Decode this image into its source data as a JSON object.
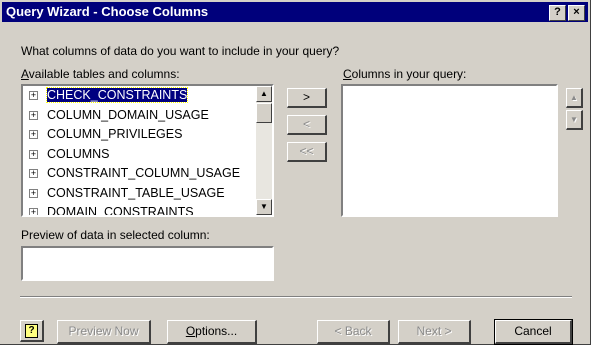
{
  "window": {
    "title": "Query Wizard - Choose Columns",
    "help_glyph": "?",
    "close_glyph": "×"
  },
  "prompt": "What columns of data do you want to include in your query?",
  "available": {
    "label_access": "A",
    "label_rest": "vailable tables and columns:",
    "items": [
      {
        "label": "CHECK_CONSTRAINTS",
        "selected": true
      },
      {
        "label": "COLUMN_DOMAIN_USAGE"
      },
      {
        "label": "COLUMN_PRIVILEGES"
      },
      {
        "label": "COLUMNS"
      },
      {
        "label": "CONSTRAINT_COLUMN_USAGE"
      },
      {
        "label": "CONSTRAINT_TABLE_USAGE"
      },
      {
        "label": "DOMAIN_CONSTRAINTS"
      }
    ],
    "expander_glyph": "+"
  },
  "move_buttons": {
    "add": ">",
    "remove": "<",
    "remove_all": "<<"
  },
  "query_columns": {
    "label_access": "C",
    "label_rest": "olumns in your query:"
  },
  "preview": {
    "label": "Preview of data in selected column:",
    "value": ""
  },
  "footer": {
    "help_glyph": "?",
    "preview_now": "Preview Now",
    "options_access": "O",
    "options_rest": "ptions...",
    "back": "< Back",
    "next": "Next >",
    "cancel": "Cancel"
  }
}
